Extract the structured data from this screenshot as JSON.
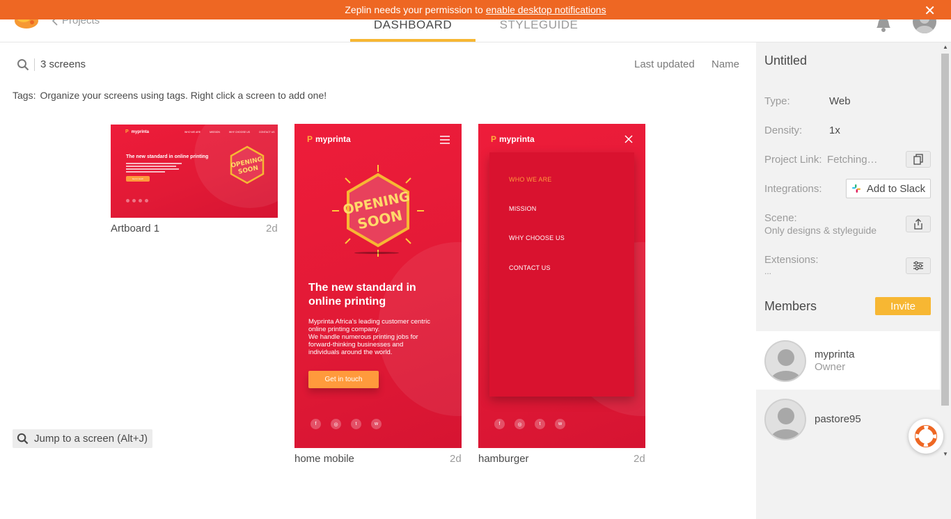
{
  "notification": {
    "text": "Zeplin needs your permission to",
    "link": "enable desktop notifications",
    "close": "✕"
  },
  "header": {
    "back_label": "Projects",
    "tabs": [
      {
        "label": "DASHBOARD",
        "active": true
      },
      {
        "label": "STYLEGUIDE",
        "active": false
      }
    ]
  },
  "toolbar": {
    "screen_count": "3 screens",
    "sort_last_updated": "Last updated",
    "sort_name": "Name"
  },
  "tags": {
    "label": "Tags:",
    "hint": "Organize your screens using tags. Right click a screen to add one!"
  },
  "screens": [
    {
      "name": "Artboard 1",
      "updated": "2d",
      "brand": "myprinta",
      "nav": [
        "WHO WE ARE",
        "MISSION",
        "WHY CHOOSE US",
        "CONTACT US"
      ],
      "hero_title": "The new standard in online printing",
      "badge_top": "OPENING",
      "badge_bottom": "SOON",
      "cta": "Get in touch"
    },
    {
      "name": "home mobile",
      "updated": "2d",
      "brand": "myprinta",
      "badge_top": "OPENING",
      "badge_bottom": "SOON",
      "hero_title_1": "The new standard in",
      "hero_title_2": "online printing",
      "hero_body_1": "Myprinta Africa's leading customer centric",
      "hero_body_2": "online printing company.",
      "hero_body_3": "We handle numerous printing jobs for",
      "hero_body_4": "forward-thinking businesses and",
      "hero_body_5": "individuals around the world.",
      "cta": "Get in touch",
      "socials": [
        "f",
        "◎",
        "t",
        "w"
      ]
    },
    {
      "name": "hamburger",
      "updated": "2d",
      "brand": "myprinta",
      "menu": [
        "WHO WE ARE",
        "MISSION",
        "WHY CHOOSE US",
        "CONTACT US"
      ],
      "socials": [
        "f",
        "◎",
        "t",
        "w"
      ]
    }
  ],
  "jump": {
    "label": "Jump to a screen (Alt+J)"
  },
  "panel": {
    "title": "Untitled",
    "type_label": "Type:",
    "type_value": "Web",
    "density_label": "Density:",
    "density_value": "1x",
    "link_label": "Project Link:",
    "link_value": "Fetching…",
    "integrations_label": "Integrations:",
    "slack_button": "Add to Slack",
    "scene_label": "Scene:",
    "scene_value": "Only designs & styleguide",
    "extensions_label": "Extensions:",
    "extensions_value": "...",
    "members_title": "Members",
    "invite_button": "Invite",
    "members": [
      {
        "name": "myprinta",
        "role": "Owner"
      },
      {
        "name": "pastore95",
        "role": ""
      }
    ]
  },
  "colors": {
    "brand_orange": "#ee6723",
    "accent_yellow": "#f7b733",
    "design_red": "#e21a36",
    "design_cta": "#ff9a3c"
  }
}
